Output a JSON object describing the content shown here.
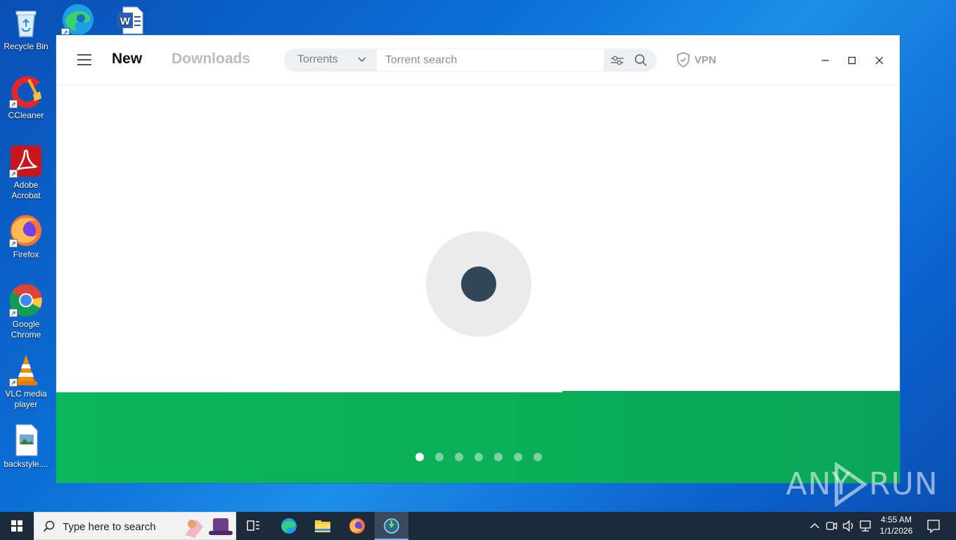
{
  "desktop": {
    "icons": [
      {
        "label": "Recycle Bin"
      },
      {
        "label": "CCleaner"
      },
      {
        "label": "Adobe Acrobat"
      },
      {
        "label": "Firefox"
      },
      {
        "label": "Google Chrome"
      },
      {
        "label": "VLC media player"
      },
      {
        "label": "backstyle...."
      }
    ]
  },
  "app": {
    "tabs": {
      "new": "New",
      "downloads": "Downloads"
    },
    "search": {
      "category": "Torrents",
      "placeholder": "Torrent search"
    },
    "vpn_label": "VPN",
    "carousel": {
      "count": 7,
      "active_index": 0
    },
    "colors": {
      "banner": "#0ab55a",
      "spinner_inner": "#33475b",
      "spinner_outer": "#ebebec"
    }
  },
  "watermark": {
    "left": "ANY",
    "right": "RUN"
  },
  "taskbar": {
    "search_placeholder": "Type here to search",
    "clock": {
      "time": "4:55 AM",
      "date": "1/1/2026"
    }
  }
}
